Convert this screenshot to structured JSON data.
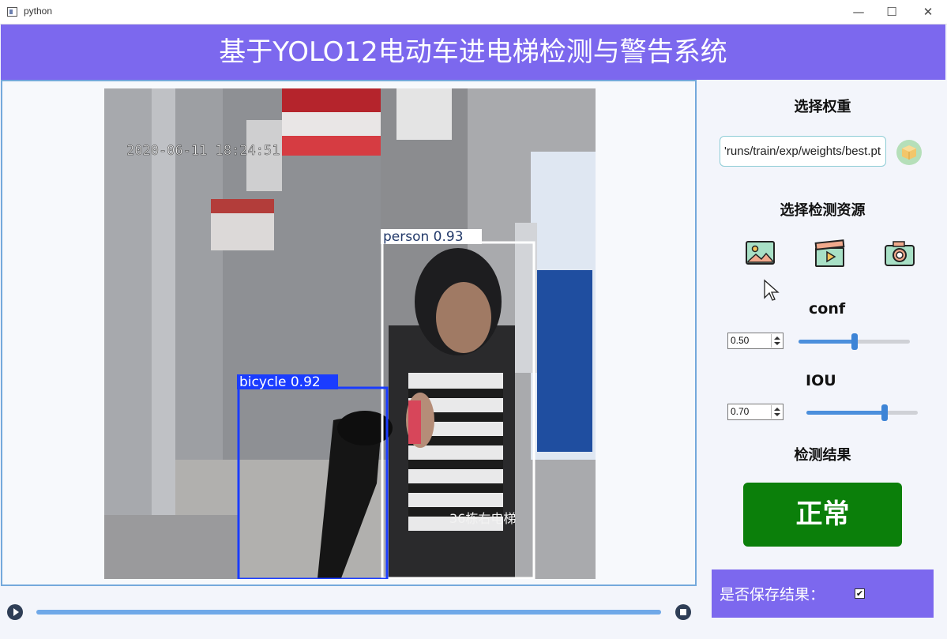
{
  "window": {
    "title": "python",
    "minimize_glyph": "—",
    "maximize_glyph": "☐",
    "close_glyph": "✕"
  },
  "header": {
    "title": "基于YOLO12电动车进电梯检测与警告系统"
  },
  "video": {
    "timestamp": "2020-06-11 18:24:51",
    "watermark": "36栋右电梯",
    "detections": [
      {
        "label": "person 0.93",
        "color": "#ffffff"
      },
      {
        "label": "bicycle 0.92",
        "color": "#1a3cff"
      }
    ],
    "progress_fraction": 1.0
  },
  "panel": {
    "weights_title": "选择权重",
    "weights_path": "'runs/train/exp/weights/best.pt",
    "source_title": "选择检测资源",
    "source_buttons": [
      "image-icon",
      "video-icon",
      "camera-icon"
    ],
    "conf_label": "conf",
    "conf_value": "0.50",
    "conf_fraction": 0.5,
    "iou_label": "IOU",
    "iou_value": "0.70",
    "iou_fraction": 0.7,
    "result_title": "检测结果",
    "result_text": "正常",
    "save_label": "是否保存结果：",
    "save_checked": "✔"
  },
  "colors": {
    "accent": "#7c68ee",
    "result_ok": "#0b7f0a",
    "slider": "#4b8fdc"
  }
}
